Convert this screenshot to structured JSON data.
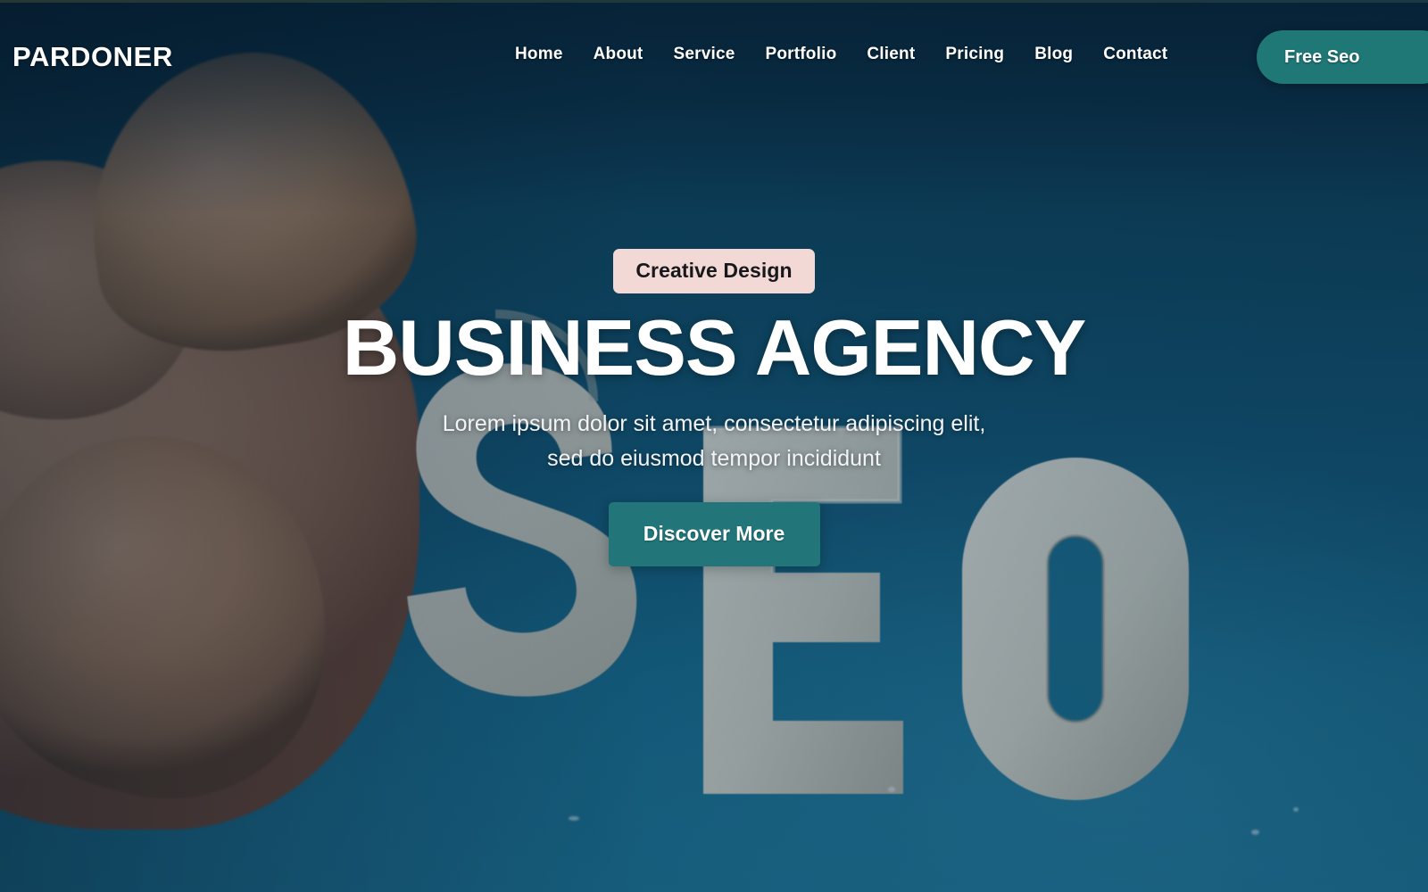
{
  "header": {
    "brand": "PARDONER",
    "nav": [
      {
        "label": "Home"
      },
      {
        "label": "About"
      },
      {
        "label": "Service"
      },
      {
        "label": "Portfolio"
      },
      {
        "label": "Client"
      },
      {
        "label": "Pricing"
      },
      {
        "label": "Blog"
      },
      {
        "label": "Contact"
      }
    ],
    "cta_label": "Free Seo"
  },
  "hero": {
    "badge": "Creative Design",
    "title": "BUSINESS AGENCY",
    "subtitle_line1": "Lorem ipsum dolor sit amet, consectetur adipiscing elit,",
    "subtitle_line2": "sed do eiusmod tempor incididunt",
    "button_label": "Discover More",
    "background_description": "Photograph of a hand holding a light grey letter S beside letters E and O on a blue surface"
  },
  "colors": {
    "background_blue": "#0e3450",
    "surface_blue": "#166a8e",
    "accent_teal": "#22767a",
    "cta_teal": "#1f7776",
    "badge_pink": "#f3d9d6",
    "text_white": "#ffffff"
  }
}
